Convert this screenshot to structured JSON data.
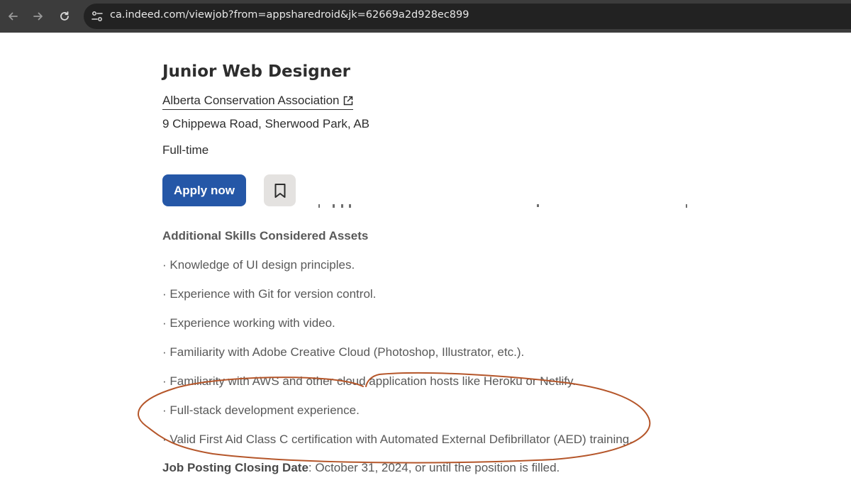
{
  "browser": {
    "url": "ca.indeed.com/viewjob?from=appsharedroid&jk=62669a2d928ec899"
  },
  "job": {
    "title": "Junior Web Designer",
    "company": "Alberta Conservation Association",
    "location": "9 Chippewa Road, Sherwood Park, AB",
    "type": "Full-time",
    "apply_label": "Apply now"
  },
  "description": {
    "section_heading": "Additional Skills Considered Assets",
    "bullets": [
      "· Knowledge of UI design principles.",
      "· Experience with Git for version control.",
      "· Experience working with video.",
      "· Familiarity with Adobe Creative Cloud (Photoshop, Illustrator, etc.).",
      "· Familiarity with AWS and other cloud application hosts like Heroku or Netlify.",
      "· Full-stack development experience.",
      "· Valid First Aid Class C certification with Automated External Defibrillator (AED) training."
    ],
    "closing_label": "Job Posting Closing Date",
    "closing_value": ": October 31, 2024, or until the position is filled."
  },
  "colors": {
    "toolbar": "#3c3c3c",
    "apply_button": "#2557a7",
    "annotation_ink": "#b5562a"
  }
}
